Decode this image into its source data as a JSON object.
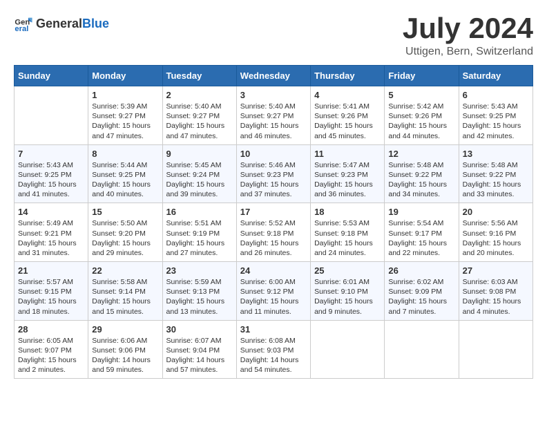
{
  "header": {
    "logo_general": "General",
    "logo_blue": "Blue",
    "title": "July 2024",
    "location": "Uttigen, Bern, Switzerland"
  },
  "weekdays": [
    "Sunday",
    "Monday",
    "Tuesday",
    "Wednesday",
    "Thursday",
    "Friday",
    "Saturday"
  ],
  "weeks": [
    [
      {
        "day": "",
        "info": ""
      },
      {
        "day": "1",
        "info": "Sunrise: 5:39 AM\nSunset: 9:27 PM\nDaylight: 15 hours\nand 47 minutes."
      },
      {
        "day": "2",
        "info": "Sunrise: 5:40 AM\nSunset: 9:27 PM\nDaylight: 15 hours\nand 47 minutes."
      },
      {
        "day": "3",
        "info": "Sunrise: 5:40 AM\nSunset: 9:27 PM\nDaylight: 15 hours\nand 46 minutes."
      },
      {
        "day": "4",
        "info": "Sunrise: 5:41 AM\nSunset: 9:26 PM\nDaylight: 15 hours\nand 45 minutes."
      },
      {
        "day": "5",
        "info": "Sunrise: 5:42 AM\nSunset: 9:26 PM\nDaylight: 15 hours\nand 44 minutes."
      },
      {
        "day": "6",
        "info": "Sunrise: 5:43 AM\nSunset: 9:25 PM\nDaylight: 15 hours\nand 42 minutes."
      }
    ],
    [
      {
        "day": "7",
        "info": "Sunrise: 5:43 AM\nSunset: 9:25 PM\nDaylight: 15 hours\nand 41 minutes."
      },
      {
        "day": "8",
        "info": "Sunrise: 5:44 AM\nSunset: 9:25 PM\nDaylight: 15 hours\nand 40 minutes."
      },
      {
        "day": "9",
        "info": "Sunrise: 5:45 AM\nSunset: 9:24 PM\nDaylight: 15 hours\nand 39 minutes."
      },
      {
        "day": "10",
        "info": "Sunrise: 5:46 AM\nSunset: 9:23 PM\nDaylight: 15 hours\nand 37 minutes."
      },
      {
        "day": "11",
        "info": "Sunrise: 5:47 AM\nSunset: 9:23 PM\nDaylight: 15 hours\nand 36 minutes."
      },
      {
        "day": "12",
        "info": "Sunrise: 5:48 AM\nSunset: 9:22 PM\nDaylight: 15 hours\nand 34 minutes."
      },
      {
        "day": "13",
        "info": "Sunrise: 5:48 AM\nSunset: 9:22 PM\nDaylight: 15 hours\nand 33 minutes."
      }
    ],
    [
      {
        "day": "14",
        "info": "Sunrise: 5:49 AM\nSunset: 9:21 PM\nDaylight: 15 hours\nand 31 minutes."
      },
      {
        "day": "15",
        "info": "Sunrise: 5:50 AM\nSunset: 9:20 PM\nDaylight: 15 hours\nand 29 minutes."
      },
      {
        "day": "16",
        "info": "Sunrise: 5:51 AM\nSunset: 9:19 PM\nDaylight: 15 hours\nand 27 minutes."
      },
      {
        "day": "17",
        "info": "Sunrise: 5:52 AM\nSunset: 9:18 PM\nDaylight: 15 hours\nand 26 minutes."
      },
      {
        "day": "18",
        "info": "Sunrise: 5:53 AM\nSunset: 9:18 PM\nDaylight: 15 hours\nand 24 minutes."
      },
      {
        "day": "19",
        "info": "Sunrise: 5:54 AM\nSunset: 9:17 PM\nDaylight: 15 hours\nand 22 minutes."
      },
      {
        "day": "20",
        "info": "Sunrise: 5:56 AM\nSunset: 9:16 PM\nDaylight: 15 hours\nand 20 minutes."
      }
    ],
    [
      {
        "day": "21",
        "info": "Sunrise: 5:57 AM\nSunset: 9:15 PM\nDaylight: 15 hours\nand 18 minutes."
      },
      {
        "day": "22",
        "info": "Sunrise: 5:58 AM\nSunset: 9:14 PM\nDaylight: 15 hours\nand 15 minutes."
      },
      {
        "day": "23",
        "info": "Sunrise: 5:59 AM\nSunset: 9:13 PM\nDaylight: 15 hours\nand 13 minutes."
      },
      {
        "day": "24",
        "info": "Sunrise: 6:00 AM\nSunset: 9:12 PM\nDaylight: 15 hours\nand 11 minutes."
      },
      {
        "day": "25",
        "info": "Sunrise: 6:01 AM\nSunset: 9:10 PM\nDaylight: 15 hours\nand 9 minutes."
      },
      {
        "day": "26",
        "info": "Sunrise: 6:02 AM\nSunset: 9:09 PM\nDaylight: 15 hours\nand 7 minutes."
      },
      {
        "day": "27",
        "info": "Sunrise: 6:03 AM\nSunset: 9:08 PM\nDaylight: 15 hours\nand 4 minutes."
      }
    ],
    [
      {
        "day": "28",
        "info": "Sunrise: 6:05 AM\nSunset: 9:07 PM\nDaylight: 15 hours\nand 2 minutes."
      },
      {
        "day": "29",
        "info": "Sunrise: 6:06 AM\nSunset: 9:06 PM\nDaylight: 14 hours\nand 59 minutes."
      },
      {
        "day": "30",
        "info": "Sunrise: 6:07 AM\nSunset: 9:04 PM\nDaylight: 14 hours\nand 57 minutes."
      },
      {
        "day": "31",
        "info": "Sunrise: 6:08 AM\nSunset: 9:03 PM\nDaylight: 14 hours\nand 54 minutes."
      },
      {
        "day": "",
        "info": ""
      },
      {
        "day": "",
        "info": ""
      },
      {
        "day": "",
        "info": ""
      }
    ]
  ]
}
